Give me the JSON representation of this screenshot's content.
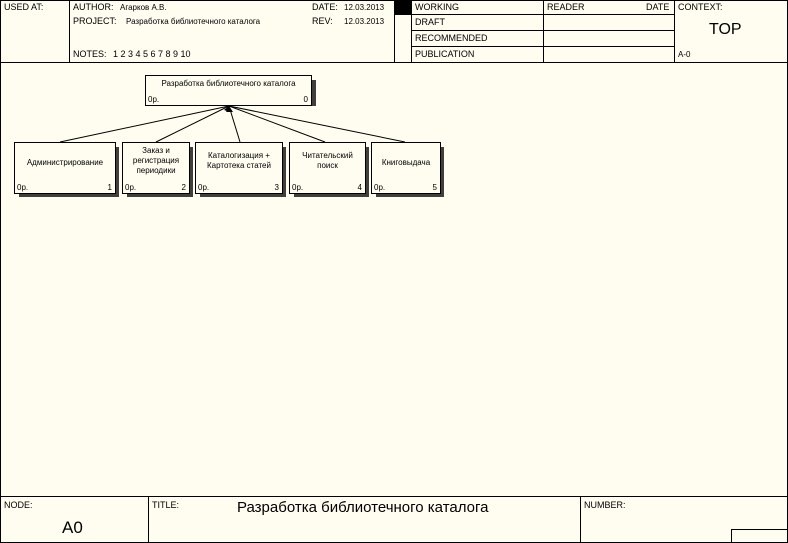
{
  "header": {
    "used_at_label": "USED AT:",
    "author_label": "AUTHOR:",
    "author_value": "Агарков А.В.",
    "project_label": "PROJECT:",
    "project_value": "Разработка библиотечного каталога",
    "date_label": "DATE:",
    "date_value": "12.03.2013",
    "rev_label": "REV:",
    "rev_value": "12.03.2013",
    "notes_label": "NOTES:",
    "notes_numbers": "1  2  3  4  5  6  7  8  9  10",
    "statuses": [
      "WORKING",
      "DRAFT",
      "RECOMMENDED",
      "PUBLICATION"
    ],
    "reader_label": "READER",
    "reader_date_label": "DATE",
    "context_label": "CONTEXT:",
    "context_value": "TOP",
    "context_node": "A-0"
  },
  "diagram": {
    "root": {
      "label": "Разработка библиотечного каталога",
      "cost": "0р.",
      "number": "0"
    },
    "children": [
      {
        "label": "Администрирование",
        "cost": "0р.",
        "number": "1"
      },
      {
        "label": "Заказ и\nрегистрация\nпериодики",
        "cost": "0р.",
        "number": "2"
      },
      {
        "label": "Каталогизация +\nКартотека статей",
        "cost": "0р.",
        "number": "3"
      },
      {
        "label": "Читательский\nпоиск",
        "cost": "0р.",
        "number": "4"
      },
      {
        "label": "Книговыдача",
        "cost": "0р.",
        "number": "5"
      }
    ]
  },
  "footer": {
    "node_label": "NODE:",
    "node_value": "A0",
    "title_label": "TITLE:",
    "title_value": "Разработка библиотечного каталога",
    "number_label": "NUMBER:"
  }
}
